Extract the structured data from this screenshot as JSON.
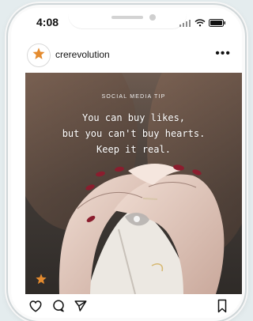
{
  "status_bar": {
    "time": "4:08"
  },
  "post": {
    "username": "crerevolution",
    "more_label": "•••",
    "label": "SOCIAL MEDIA TIP",
    "quote_lines": [
      "You can buy likes,",
      "but you can't buy hearts.",
      "Keep it real."
    ]
  },
  "colors": {
    "accent": "#e48b2f",
    "text": "#111111"
  },
  "icons": {
    "like": "heart-icon",
    "comment": "comment-icon",
    "share": "send-icon",
    "save": "bookmark-icon"
  }
}
